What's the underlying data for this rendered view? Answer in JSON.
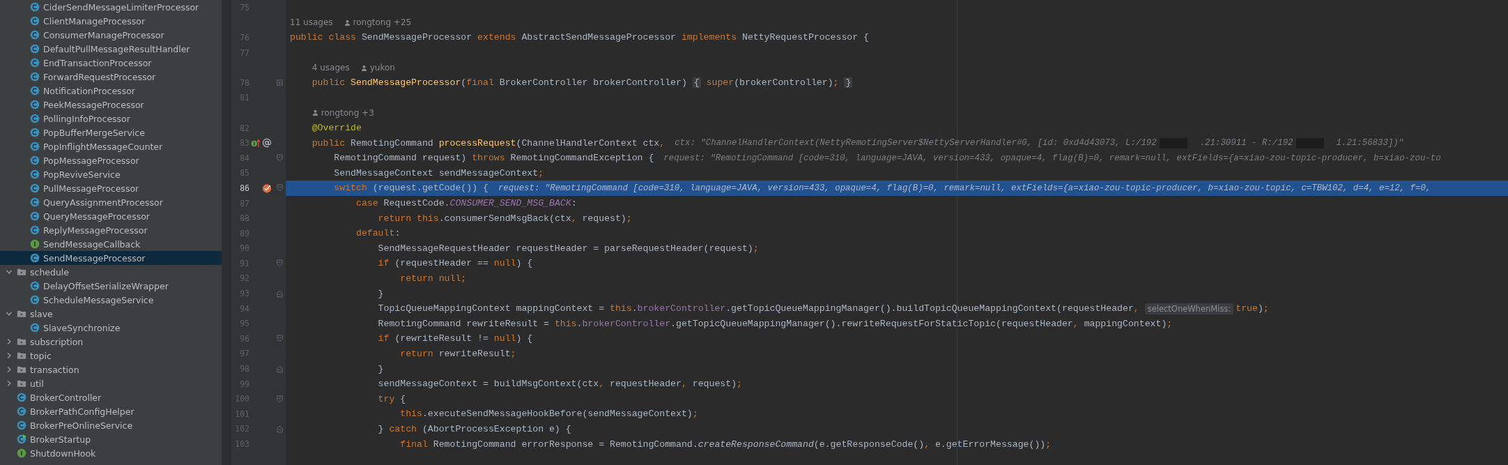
{
  "project_tree": {
    "continued_items": [
      {
        "name": "CiderSendMessageLimiterProcessor",
        "kind": "class",
        "selected": false
      },
      {
        "name": "ClientManageProcessor",
        "kind": "class",
        "selected": false
      },
      {
        "name": "ConsumerManageProcessor",
        "kind": "class",
        "selected": false
      },
      {
        "name": "DefaultPullMessageResultHandler",
        "kind": "class",
        "selected": false
      },
      {
        "name": "EndTransactionProcessor",
        "kind": "class",
        "selected": false
      },
      {
        "name": "ForwardRequestProcessor",
        "kind": "class",
        "selected": false
      },
      {
        "name": "NotificationProcessor",
        "kind": "class",
        "selected": false
      },
      {
        "name": "PeekMessageProcessor",
        "kind": "class",
        "selected": false
      },
      {
        "name": "PollingInfoProcessor",
        "kind": "class",
        "selected": false
      },
      {
        "name": "PopBufferMergeService",
        "kind": "class",
        "selected": false
      },
      {
        "name": "PopInflightMessageCounter",
        "kind": "class",
        "selected": false
      },
      {
        "name": "PopMessageProcessor",
        "kind": "class",
        "selected": false
      },
      {
        "name": "PopReviveService",
        "kind": "class",
        "selected": false
      },
      {
        "name": "PullMessageProcessor",
        "kind": "class",
        "selected": false
      },
      {
        "name": "QueryAssignmentProcessor",
        "kind": "class",
        "selected": false
      },
      {
        "name": "QueryMessageProcessor",
        "kind": "class",
        "selected": false
      },
      {
        "name": "ReplyMessageProcessor",
        "kind": "class",
        "selected": false
      },
      {
        "name": "SendMessageCallback",
        "kind": "interface",
        "selected": false
      },
      {
        "name": "SendMessageProcessor",
        "kind": "class",
        "selected": true
      }
    ],
    "items": [
      {
        "name": "schedule",
        "kind": "folder",
        "selected": false,
        "expanded": true,
        "children": [
          {
            "name": "DelayOffsetSerializeWrapper",
            "kind": "class",
            "selected": false
          },
          {
            "name": "ScheduleMessageService",
            "kind": "class",
            "selected": false
          }
        ]
      },
      {
        "name": "slave",
        "kind": "folder",
        "selected": false,
        "expanded": true,
        "children": [
          {
            "name": "SlaveSynchronize",
            "kind": "class",
            "selected": false
          }
        ]
      },
      {
        "name": "subscription",
        "kind": "folder",
        "selected": false,
        "expanded": false
      },
      {
        "name": "topic",
        "kind": "folder",
        "selected": false,
        "expanded": false
      },
      {
        "name": "transaction",
        "kind": "folder",
        "selected": false,
        "expanded": false
      },
      {
        "name": "util",
        "kind": "folder",
        "selected": false,
        "expanded": false
      },
      {
        "name": "BrokerController",
        "kind": "class",
        "selected": false
      },
      {
        "name": "BrokerPathConfigHelper",
        "kind": "class",
        "selected": false
      },
      {
        "name": "BrokerPreOnlineService",
        "kind": "class",
        "selected": false
      },
      {
        "name": "BrokerStartup",
        "kind": "main",
        "selected": false
      },
      {
        "name": "ShutdownHook",
        "kind": "interface",
        "selected": false
      }
    ]
  },
  "editor": {
    "lines": [
      {
        "kind": "code",
        "number": "75",
        "current": false
      },
      {
        "kind": "meta",
        "usages": "11 usages",
        "author": "rongtong +25"
      },
      {
        "kind": "code",
        "number": "76",
        "current": false,
        "tokens": [
          {
            "kind": "keyword",
            "t": "public class "
          },
          {
            "kind": "plain",
            "t": "SendMessageProcessor "
          },
          {
            "kind": "keyword",
            "t": "extends "
          },
          {
            "kind": "plain",
            "t": "AbstractSendMessageProcessor "
          },
          {
            "kind": "keyword",
            "t": "implements "
          },
          {
            "kind": "plain",
            "t": "NettyRequestProcessor {"
          }
        ]
      },
      {
        "kind": "code",
        "number": "77",
        "current": false
      },
      {
        "kind": "meta",
        "usages": "4 usages",
        "author": "yukon"
      },
      {
        "kind": "code",
        "number": "78",
        "current": false,
        "fold": {
          "kind": "collapsed"
        },
        "tokens": [
          {
            "kind": "keyword",
            "t": "    public "
          },
          {
            "kind": "declaration",
            "t": "SendMessageProcessor"
          },
          {
            "kind": "plain",
            "t": "("
          },
          {
            "kind": "keyword",
            "t": "final "
          },
          {
            "kind": "plain",
            "t": "BrokerController brokerController) "
          },
          {
            "kind": "folded",
            "t": "{"
          },
          {
            "kind": "keyword",
            "t": " super"
          },
          {
            "kind": "plain",
            "t": "(brokerController)"
          },
          {
            "kind": "keyword",
            "t": "; "
          },
          {
            "kind": "folded",
            "t": "}"
          }
        ]
      },
      {
        "kind": "code",
        "number": "81",
        "current": false
      },
      {
        "kind": "meta",
        "author": "rongtong +3"
      },
      {
        "kind": "code",
        "number": "82",
        "current": false,
        "tokens": [
          {
            "kind": "annotation",
            "t": "    @Override"
          }
        ]
      },
      {
        "kind": "code",
        "number": "83",
        "current": false,
        "gutter_icons": [
          {
            "kind": "override"
          },
          {
            "kind": "annotation"
          }
        ],
        "tokens": [
          {
            "kind": "keyword",
            "t": "    public "
          },
          {
            "kind": "plain",
            "t": "RemotingCommand "
          },
          {
            "kind": "declaration",
            "t": "processRequest"
          },
          {
            "kind": "plain",
            "t": "(ChannelHandlerContext ctx"
          },
          {
            "kind": "keyword",
            "t": ","
          },
          {
            "kind": "hint",
            "t": "ctx: \"ChannelHandlerContext(NettyRemotingServer$NettyServerHandler#0, [id: 0xd4d43073, L:/192"
          },
          {
            "kind": "redacted"
          },
          {
            "kind": "hint",
            "t": ".21:30911 - R:/192"
          },
          {
            "kind": "redacted"
          },
          {
            "kind": "hint",
            "t": "1.21:56833])\""
          }
        ]
      },
      {
        "kind": "code",
        "number": "84",
        "current": false,
        "fold": {
          "kind": "open"
        },
        "tokens": [
          {
            "kind": "plain",
            "t": "        RemotingCommand request) "
          },
          {
            "kind": "keyword",
            "t": "throws "
          },
          {
            "kind": "plain",
            "t": "RemotingCommandException {"
          },
          {
            "kind": "hint",
            "t": "request: \"RemotingCommand [code=310, language=JAVA, version=433, opaque=4, flag(B)=0, remark=null, extFields={a=xiao-zou-topic-producer, b=xiao-zou-to"
          }
        ]
      },
      {
        "kind": "code",
        "number": "85",
        "current": false,
        "tokens": [
          {
            "kind": "plain",
            "t": "        SendMessageContext sendMessageContext"
          },
          {
            "kind": "keyword",
            "t": ";"
          }
        ]
      },
      {
        "kind": "code",
        "number": "86",
        "current": true,
        "fold": {
          "kind": "open"
        },
        "gutter_icons": [
          {
            "kind": "breakpoint"
          }
        ],
        "tokens": [
          {
            "kind": "keyword",
            "t": "        switch "
          },
          {
            "kind": "plain",
            "t": "(request.getCode()) {"
          },
          {
            "kind": "hint",
            "t": "request: \"RemotingCommand [code=310, language=JAVA, version=433, opaque=4, flag(B)=0, remark=null, extFields={a=xiao-zou-topic-producer, b=xiao-zou-topic, c=TBW102, d=4, e=12, f=0,"
          }
        ]
      },
      {
        "kind": "code",
        "number": "87",
        "current": false,
        "tokens": [
          {
            "kind": "keyword",
            "t": "            case "
          },
          {
            "kind": "plain",
            "t": "RequestCode."
          },
          {
            "kind": "constant",
            "t": "CONSUMER_SEND_MSG_BACK"
          },
          {
            "kind": "plain",
            "t": ":"
          }
        ]
      },
      {
        "kind": "code",
        "number": "88",
        "current": false,
        "tokens": [
          {
            "kind": "keyword",
            "t": "                return this"
          },
          {
            "kind": "plain",
            "t": ".consumerSendMsgBack(ctx"
          },
          {
            "kind": "keyword",
            "t": ","
          },
          {
            "kind": "plain",
            "t": " request)"
          },
          {
            "kind": "keyword",
            "t": ";"
          }
        ]
      },
      {
        "kind": "code",
        "number": "89",
        "current": false,
        "tokens": [
          {
            "kind": "keyword",
            "t": "            default"
          },
          {
            "kind": "plain",
            "t": ":"
          }
        ]
      },
      {
        "kind": "code",
        "number": "90",
        "current": false,
        "tokens": [
          {
            "kind": "plain",
            "t": "                SendMessageRequestHeader requestHeader = parseRequestHeader(request)"
          },
          {
            "kind": "keyword",
            "t": ";"
          }
        ]
      },
      {
        "kind": "code",
        "number": "91",
        "current": false,
        "fold": {
          "kind": "open"
        },
        "tokens": [
          {
            "kind": "keyword",
            "t": "                if "
          },
          {
            "kind": "plain",
            "t": "(requestHeader == "
          },
          {
            "kind": "keyword",
            "t": "null"
          },
          {
            "kind": "plain",
            "t": ") {"
          }
        ]
      },
      {
        "kind": "code",
        "number": "92",
        "current": false,
        "tokens": [
          {
            "kind": "keyword",
            "t": "                    return null;"
          }
        ]
      },
      {
        "kind": "code",
        "number": "93",
        "current": false,
        "fold": {
          "kind": "close"
        },
        "tokens": [
          {
            "kind": "plain",
            "t": "                }"
          }
        ]
      },
      {
        "kind": "code",
        "number": "94",
        "current": false,
        "tokens": [
          {
            "kind": "plain",
            "t": "                TopicQueueMappingContext mappingContext = "
          },
          {
            "kind": "keyword",
            "t": "this"
          },
          {
            "kind": "plain",
            "t": "."
          },
          {
            "kind": "field",
            "t": "brokerController"
          },
          {
            "kind": "plain",
            "t": ".getTopicQueueMappingManager().buildTopicQueueMappingContext(requestHeader"
          },
          {
            "kind": "keyword",
            "t": ", "
          },
          {
            "kind": "param_hint",
            "t": "selectOneWhenMiss:"
          },
          {
            "kind": "keyword",
            "t": "true"
          },
          {
            "kind": "plain",
            "t": ")"
          },
          {
            "kind": "keyword",
            "t": ";"
          }
        ]
      },
      {
        "kind": "code",
        "number": "95",
        "current": false,
        "tokens": [
          {
            "kind": "plain",
            "t": "                RemotingCommand rewriteResult = "
          },
          {
            "kind": "keyword",
            "t": "this"
          },
          {
            "kind": "plain",
            "t": "."
          },
          {
            "kind": "field",
            "t": "brokerController"
          },
          {
            "kind": "plain",
            "t": ".getTopicQueueMappingManager().rewriteRequestForStaticTopic(requestHeader"
          },
          {
            "kind": "keyword",
            "t": ","
          },
          {
            "kind": "plain",
            "t": " mappingContext)"
          },
          {
            "kind": "keyword",
            "t": ";"
          }
        ]
      },
      {
        "kind": "code",
        "number": "96",
        "current": false,
        "fold": {
          "kind": "open"
        },
        "tokens": [
          {
            "kind": "keyword",
            "t": "                if "
          },
          {
            "kind": "plain",
            "t": "(rewriteResult != "
          },
          {
            "kind": "keyword",
            "t": "null"
          },
          {
            "kind": "plain",
            "t": ") {"
          }
        ]
      },
      {
        "kind": "code",
        "number": "97",
        "current": false,
        "tokens": [
          {
            "kind": "keyword",
            "t": "                    return "
          },
          {
            "kind": "plain",
            "t": "rewriteResult"
          },
          {
            "kind": "keyword",
            "t": ";"
          }
        ]
      },
      {
        "kind": "code",
        "number": "98",
        "current": false,
        "fold": {
          "kind": "close"
        },
        "tokens": [
          {
            "kind": "plain",
            "t": "                }"
          }
        ]
      },
      {
        "kind": "code",
        "number": "99",
        "current": false,
        "tokens": [
          {
            "kind": "plain",
            "t": "                sendMessageContext = buildMsgContext(ctx"
          },
          {
            "kind": "keyword",
            "t": ","
          },
          {
            "kind": "plain",
            "t": " requestHeader"
          },
          {
            "kind": "keyword",
            "t": ","
          },
          {
            "kind": "plain",
            "t": " request)"
          },
          {
            "kind": "keyword",
            "t": ";"
          }
        ]
      },
      {
        "kind": "code",
        "number": "100",
        "current": false,
        "fold": {
          "kind": "open"
        },
        "tokens": [
          {
            "kind": "keyword",
            "t": "                try "
          },
          {
            "kind": "plain",
            "t": "{"
          }
        ]
      },
      {
        "kind": "code",
        "number": "101",
        "current": false,
        "tokens": [
          {
            "kind": "keyword",
            "t": "                    this"
          },
          {
            "kind": "plain",
            "t": ".executeSendMessageHookBefore(sendMessageContext)"
          },
          {
            "kind": "keyword",
            "t": ";"
          }
        ]
      },
      {
        "kind": "code",
        "number": "102",
        "current": false,
        "fold": {
          "kind": "close"
        },
        "tokens": [
          {
            "kind": "plain",
            "t": "                } "
          },
          {
            "kind": "keyword",
            "t": "catch "
          },
          {
            "kind": "plain",
            "t": "(AbortProcessException e) {"
          }
        ]
      },
      {
        "kind": "code",
        "number": "103",
        "current": false,
        "tokens": [
          {
            "kind": "keyword",
            "t": "                    final "
          },
          {
            "kind": "plain",
            "t": "RemotingCommand errorResponse = RemotingCommand."
          },
          {
            "kind": "static_call",
            "t": "createResponseCommand"
          },
          {
            "kind": "plain",
            "t": "(e.getResponseCode()"
          },
          {
            "kind": "keyword",
            "t": ","
          },
          {
            "kind": "plain",
            "t": " e.getErrorMessage())"
          },
          {
            "kind": "keyword",
            "t": ";"
          }
        ]
      }
    ]
  }
}
